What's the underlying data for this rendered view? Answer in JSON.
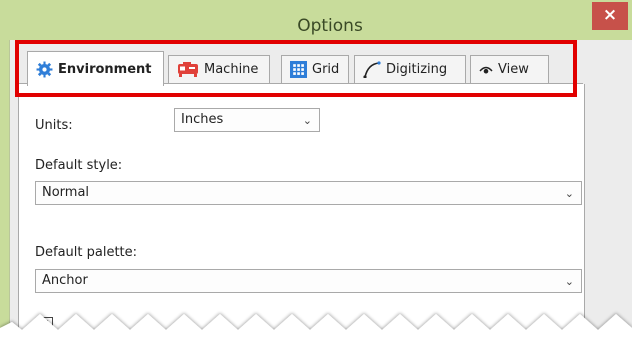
{
  "window": {
    "title": "Options",
    "close_label": "×"
  },
  "tabs": [
    {
      "label": "Environment",
      "icon": "gear-icon",
      "active": true
    },
    {
      "label": "Machine",
      "icon": "machine-icon",
      "active": false
    },
    {
      "label": "Grid",
      "icon": "grid-icon",
      "active": false
    },
    {
      "label": "Digitizing",
      "icon": "curve-icon",
      "active": false
    },
    {
      "label": "View",
      "icon": "eye-icon",
      "active": false
    }
  ],
  "settings": {
    "units": {
      "label": "Units:",
      "value": "Inches"
    },
    "default_style": {
      "label": "Default style:",
      "value": "Normal"
    },
    "default_palette": {
      "label": "Default palette:",
      "value": "Anchor"
    },
    "partial_checkbox": {
      "checked": true,
      "visible_text": ""
    }
  },
  "colors": {
    "title_bar": "#c8dc9b",
    "close_button": "#c7514a",
    "highlight_box": "#e10000",
    "gear_icon": "#2f7ed8",
    "machine_icon": "#e0413a",
    "grid_icon": "#2f7ed8"
  }
}
